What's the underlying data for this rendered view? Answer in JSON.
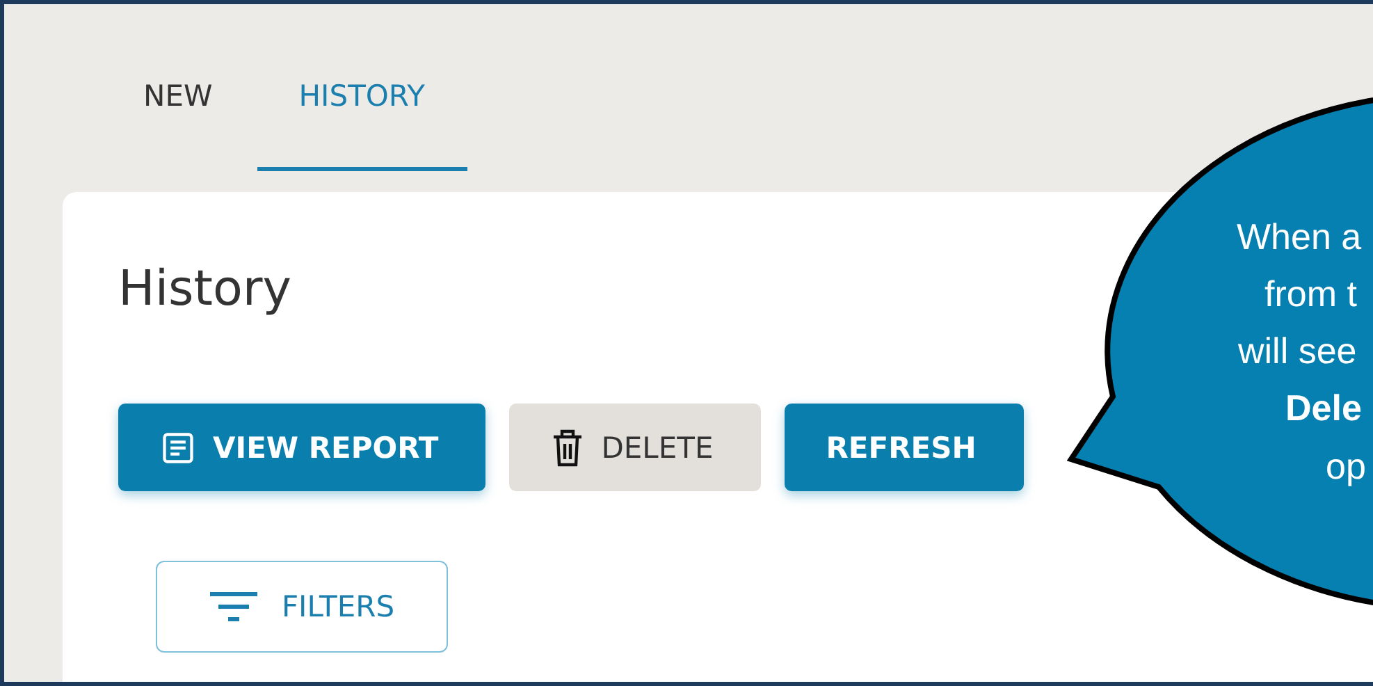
{
  "tabs": [
    {
      "label": "NEW",
      "selected": false
    },
    {
      "label": "HISTORY",
      "selected": true
    }
  ],
  "card": {
    "title": "History",
    "buttons": [
      {
        "label": "VIEW REPORT",
        "kind": "primary"
      },
      {
        "label": "DELETE",
        "kind": "secondary"
      },
      {
        "label": "REFRESH",
        "kind": "primary"
      }
    ],
    "filters": {
      "label": "FILTERS"
    }
  },
  "callout": {
    "lines": [
      {
        "text": "When a",
        "bold": false
      },
      {
        "text": "from t",
        "bold": false
      },
      {
        "text": "will see",
        "bold": false
      },
      {
        "text": "Dele",
        "bold": true
      },
      {
        "text": "op",
        "bold": false
      }
    ]
  }
}
